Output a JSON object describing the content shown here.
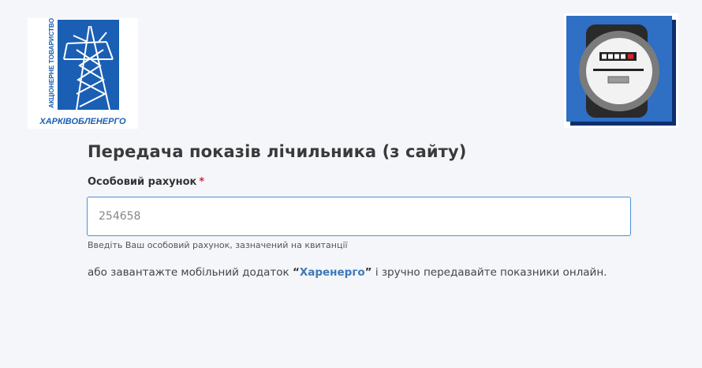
{
  "branding": {
    "company_vertical_text": "АКЦІОНЕРНЕ ТОВАРИСТВО",
    "company_name": "ХАРКІВОБЛЕНЕРГО"
  },
  "page": {
    "title": "Передача показів лічильника (з сайту)"
  },
  "form": {
    "account_label": "Особовий рахунок",
    "required_mark": "*",
    "account_value": "254658",
    "account_hint": "Введіть Ваш особовий рахунок, зазначений на квитанції"
  },
  "app_promo": {
    "text_before": "або завантажте мобільний додаток ",
    "quote_open": "“",
    "app_name": "Харенерго",
    "quote_close": "”",
    "text_after": " і зручно передавайте показники онлайн."
  },
  "colors": {
    "background": "#f4f6fa",
    "brand_blue": "#1a5fb4",
    "input_border": "#4d90d6",
    "required": "#d9282f",
    "link": "#3d78b8"
  },
  "icons": {
    "left_logo": "power-pylon-logo",
    "right_logo": "electric-meter-icon"
  }
}
